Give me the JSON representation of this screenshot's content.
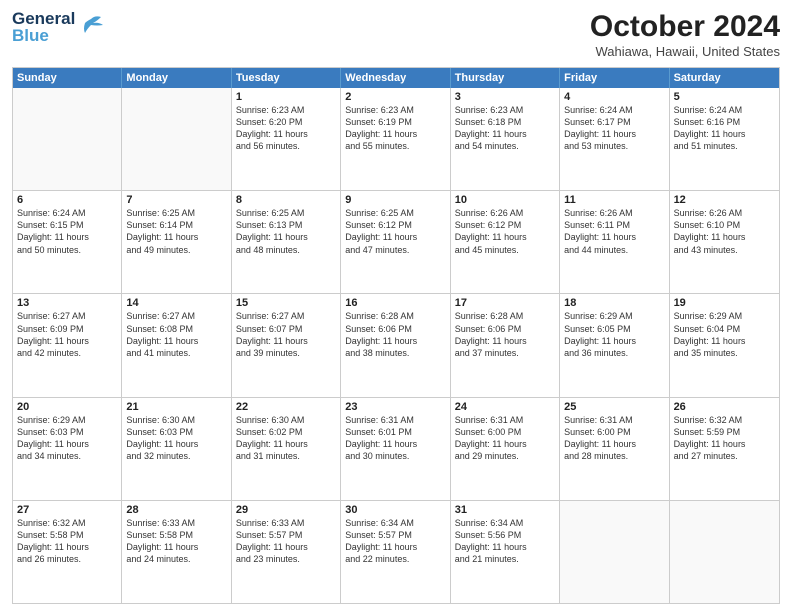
{
  "header": {
    "logo_line1": "General",
    "logo_line2": "Blue",
    "month": "October 2024",
    "location": "Wahiawa, Hawaii, United States"
  },
  "weekdays": [
    "Sunday",
    "Monday",
    "Tuesday",
    "Wednesday",
    "Thursday",
    "Friday",
    "Saturday"
  ],
  "rows": [
    [
      {
        "day": "",
        "empty": true
      },
      {
        "day": "",
        "empty": true
      },
      {
        "day": "1",
        "lines": [
          "Sunrise: 6:23 AM",
          "Sunset: 6:20 PM",
          "Daylight: 11 hours",
          "and 56 minutes."
        ]
      },
      {
        "day": "2",
        "lines": [
          "Sunrise: 6:23 AM",
          "Sunset: 6:19 PM",
          "Daylight: 11 hours",
          "and 55 minutes."
        ]
      },
      {
        "day": "3",
        "lines": [
          "Sunrise: 6:23 AM",
          "Sunset: 6:18 PM",
          "Daylight: 11 hours",
          "and 54 minutes."
        ]
      },
      {
        "day": "4",
        "lines": [
          "Sunrise: 6:24 AM",
          "Sunset: 6:17 PM",
          "Daylight: 11 hours",
          "and 53 minutes."
        ]
      },
      {
        "day": "5",
        "lines": [
          "Sunrise: 6:24 AM",
          "Sunset: 6:16 PM",
          "Daylight: 11 hours",
          "and 51 minutes."
        ]
      }
    ],
    [
      {
        "day": "6",
        "lines": [
          "Sunrise: 6:24 AM",
          "Sunset: 6:15 PM",
          "Daylight: 11 hours",
          "and 50 minutes."
        ]
      },
      {
        "day": "7",
        "lines": [
          "Sunrise: 6:25 AM",
          "Sunset: 6:14 PM",
          "Daylight: 11 hours",
          "and 49 minutes."
        ]
      },
      {
        "day": "8",
        "lines": [
          "Sunrise: 6:25 AM",
          "Sunset: 6:13 PM",
          "Daylight: 11 hours",
          "and 48 minutes."
        ]
      },
      {
        "day": "9",
        "lines": [
          "Sunrise: 6:25 AM",
          "Sunset: 6:12 PM",
          "Daylight: 11 hours",
          "and 47 minutes."
        ]
      },
      {
        "day": "10",
        "lines": [
          "Sunrise: 6:26 AM",
          "Sunset: 6:12 PM",
          "Daylight: 11 hours",
          "and 45 minutes."
        ]
      },
      {
        "day": "11",
        "lines": [
          "Sunrise: 6:26 AM",
          "Sunset: 6:11 PM",
          "Daylight: 11 hours",
          "and 44 minutes."
        ]
      },
      {
        "day": "12",
        "lines": [
          "Sunrise: 6:26 AM",
          "Sunset: 6:10 PM",
          "Daylight: 11 hours",
          "and 43 minutes."
        ]
      }
    ],
    [
      {
        "day": "13",
        "lines": [
          "Sunrise: 6:27 AM",
          "Sunset: 6:09 PM",
          "Daylight: 11 hours",
          "and 42 minutes."
        ]
      },
      {
        "day": "14",
        "lines": [
          "Sunrise: 6:27 AM",
          "Sunset: 6:08 PM",
          "Daylight: 11 hours",
          "and 41 minutes."
        ]
      },
      {
        "day": "15",
        "lines": [
          "Sunrise: 6:27 AM",
          "Sunset: 6:07 PM",
          "Daylight: 11 hours",
          "and 39 minutes."
        ]
      },
      {
        "day": "16",
        "lines": [
          "Sunrise: 6:28 AM",
          "Sunset: 6:06 PM",
          "Daylight: 11 hours",
          "and 38 minutes."
        ]
      },
      {
        "day": "17",
        "lines": [
          "Sunrise: 6:28 AM",
          "Sunset: 6:06 PM",
          "Daylight: 11 hours",
          "and 37 minutes."
        ]
      },
      {
        "day": "18",
        "lines": [
          "Sunrise: 6:29 AM",
          "Sunset: 6:05 PM",
          "Daylight: 11 hours",
          "and 36 minutes."
        ]
      },
      {
        "day": "19",
        "lines": [
          "Sunrise: 6:29 AM",
          "Sunset: 6:04 PM",
          "Daylight: 11 hours",
          "and 35 minutes."
        ]
      }
    ],
    [
      {
        "day": "20",
        "lines": [
          "Sunrise: 6:29 AM",
          "Sunset: 6:03 PM",
          "Daylight: 11 hours",
          "and 34 minutes."
        ]
      },
      {
        "day": "21",
        "lines": [
          "Sunrise: 6:30 AM",
          "Sunset: 6:03 PM",
          "Daylight: 11 hours",
          "and 32 minutes."
        ]
      },
      {
        "day": "22",
        "lines": [
          "Sunrise: 6:30 AM",
          "Sunset: 6:02 PM",
          "Daylight: 11 hours",
          "and 31 minutes."
        ]
      },
      {
        "day": "23",
        "lines": [
          "Sunrise: 6:31 AM",
          "Sunset: 6:01 PM",
          "Daylight: 11 hours",
          "and 30 minutes."
        ]
      },
      {
        "day": "24",
        "lines": [
          "Sunrise: 6:31 AM",
          "Sunset: 6:00 PM",
          "Daylight: 11 hours",
          "and 29 minutes."
        ]
      },
      {
        "day": "25",
        "lines": [
          "Sunrise: 6:31 AM",
          "Sunset: 6:00 PM",
          "Daylight: 11 hours",
          "and 28 minutes."
        ]
      },
      {
        "day": "26",
        "lines": [
          "Sunrise: 6:32 AM",
          "Sunset: 5:59 PM",
          "Daylight: 11 hours",
          "and 27 minutes."
        ]
      }
    ],
    [
      {
        "day": "27",
        "lines": [
          "Sunrise: 6:32 AM",
          "Sunset: 5:58 PM",
          "Daylight: 11 hours",
          "and 26 minutes."
        ]
      },
      {
        "day": "28",
        "lines": [
          "Sunrise: 6:33 AM",
          "Sunset: 5:58 PM",
          "Daylight: 11 hours",
          "and 24 minutes."
        ]
      },
      {
        "day": "29",
        "lines": [
          "Sunrise: 6:33 AM",
          "Sunset: 5:57 PM",
          "Daylight: 11 hours",
          "and 23 minutes."
        ]
      },
      {
        "day": "30",
        "lines": [
          "Sunrise: 6:34 AM",
          "Sunset: 5:57 PM",
          "Daylight: 11 hours",
          "and 22 minutes."
        ]
      },
      {
        "day": "31",
        "lines": [
          "Sunrise: 6:34 AM",
          "Sunset: 5:56 PM",
          "Daylight: 11 hours",
          "and 21 minutes."
        ]
      },
      {
        "day": "",
        "empty": true
      },
      {
        "day": "",
        "empty": true
      }
    ]
  ]
}
